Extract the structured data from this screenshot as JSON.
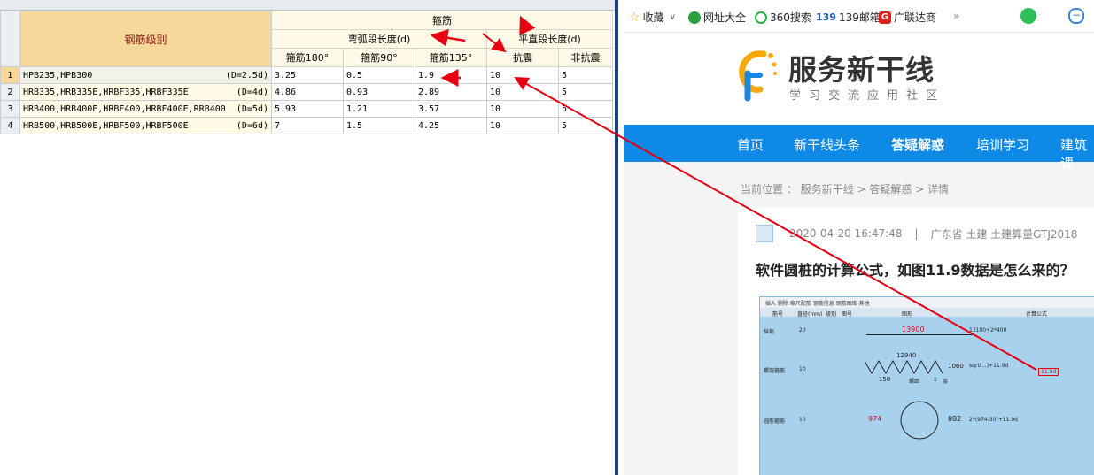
{
  "left_table": {
    "header_group": "箍筋",
    "grade_header": "钢筋级别",
    "arc_header": "弯弧段长度(d)",
    "straight_header": "平直段长度(d)",
    "columns": [
      "箍筋180°",
      "箍筋90°",
      "箍筋135°",
      "抗震",
      "非抗震"
    ],
    "rows": [
      {
        "num": "1",
        "grade": "HPB235,HPB300",
        "d": "(D=2.5d)",
        "values": [
          "3.25",
          "0.5",
          "1.9",
          "10",
          "5"
        ]
      },
      {
        "num": "2",
        "grade": "HRB335,HRB335E,HRBF335,HRBF335E",
        "d": "(D=4d)",
        "values": [
          "4.86",
          "0.93",
          "2.89",
          "10",
          "5"
        ]
      },
      {
        "num": "3",
        "grade": "HRB400,HRB400E,HRBF400,HRBF400E,RRB400",
        "d": "(D=5d)",
        "values": [
          "5.93",
          "1.21",
          "3.57",
          "10",
          "5"
        ]
      },
      {
        "num": "4",
        "grade": "HRB500,HRB500E,HRBF500,HRBF500E",
        "d": "(D=6d)",
        "values": [
          "7",
          "1.5",
          "4.25",
          "10",
          "5"
        ]
      }
    ]
  },
  "bookmarks": [
    "收藏",
    "网址大全",
    "360搜索",
    "139邮箱",
    "广联达商"
  ],
  "site": {
    "logo_title": "服务新干线",
    "logo_sub": "学习交流应用社区",
    "nav": [
      "首页",
      "新干线头条",
      "答疑解惑",
      "培训学习",
      "建筑课"
    ],
    "breadcrumb": "当前位置 ： 服务新干线 > 答疑解惑 > 详情",
    "post_meta_date": "2020-04-20 16:47:48",
    "post_meta_sep": "|",
    "post_meta_location": "广东省  土建  土建算量GTJ2018",
    "question_title": "软件圆桩的计算公式，如图11.9数据是怎么来的？"
  },
  "embedded_screenshot": {
    "toolbar": "插入  删除  缩尺配筋  钢筋信息  钢筋图库  其他",
    "headers": [
      "筋号",
      "直径(mm)",
      "级别",
      "图号",
      "图形",
      "计算公式"
    ],
    "rows": [
      {
        "name": "纵筋",
        "dia": "20",
        "figure_value": "13900",
        "formula": "13100+2*400"
      },
      {
        "name": "螺旋箍筋",
        "dia": "10",
        "figure_values": [
          "12940",
          "1060",
          "150"
        ],
        "figure_label": "螺距",
        "figure_count": "1",
        "figure_unit": "层",
        "formula": "sqrt(...)+11.9d",
        "highlight": "11.9d"
      },
      {
        "name": "圆形箍筋",
        "dia": "10",
        "figure_values": [
          "974",
          "882"
        ],
        "formula": "2*(974-30)+11.9d"
      }
    ]
  },
  "colors": {
    "nav_bg": "#0f89e6",
    "arrow": "#e60012",
    "grade_header_bg": "#f7d79a",
    "splitter": "#1a3f7a"
  }
}
